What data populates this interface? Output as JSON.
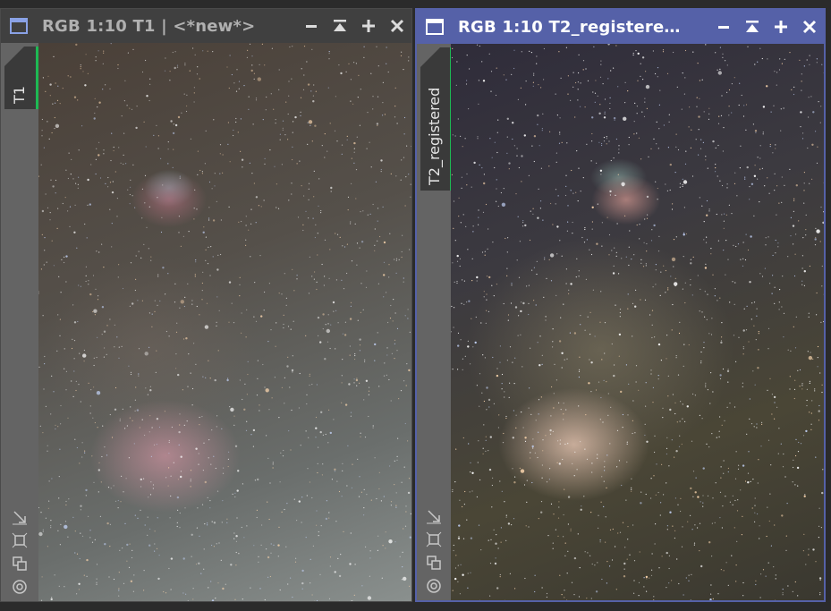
{
  "windows": [
    {
      "title": "RGB 1:10 T1 | <*new*>",
      "tab_label": "T1",
      "active": false
    },
    {
      "title": "RGB 1:10 T2_registere…",
      "tab_label": "T2_registered",
      "active": true
    }
  ],
  "title_controls": [
    "minimize-icon",
    "shade-icon",
    "maximize-icon",
    "close-icon"
  ],
  "side_tools": [
    "fit-view-icon",
    "zoom-to-fit-icon",
    "clone-icon",
    "target-icon"
  ],
  "colors": {
    "active_titlebar": "#5561a8",
    "inactive_titlebar": "#404040",
    "tab_indicator": "#1db954",
    "sidebar": "#646464"
  }
}
